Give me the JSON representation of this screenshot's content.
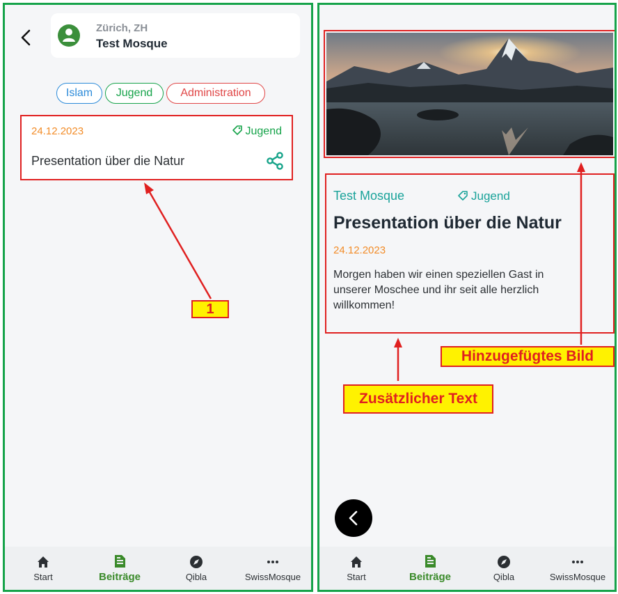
{
  "left": {
    "header": {
      "city": "Zürich, ZH",
      "mosque": "Test Mosque"
    },
    "chips": [
      "Islam",
      "Jugend",
      "Administration"
    ],
    "post": {
      "date": "24.12.2023",
      "tag": "Jugend",
      "title": "Presentation über die Natur"
    },
    "callout": "1"
  },
  "right": {
    "mosque": "Test Mosque",
    "tag": "Jugend",
    "title": "Presentation über die Natur",
    "date": "24.12.2023",
    "body": "Morgen haben wir einen speziellen Gast in unserer Moschee und ihr seit alle herzlich willkommen!",
    "callout_image": "Hinzugefügtes Bild",
    "callout_text": "Zusätzlicher Text"
  },
  "nav": [
    "Start",
    "Beiträge",
    "Qibla",
    "SwissMosque"
  ],
  "colors": {
    "frame": "#16a34a",
    "annotation": "#e02020",
    "callout_bg": "#fff200",
    "teal": "#1aa39a",
    "orange": "#f28c28"
  },
  "icons": [
    "back-chevron-icon",
    "mosque-avatar-icon",
    "tag-icon",
    "share-icon",
    "home-icon",
    "document-icon",
    "compass-icon",
    "more-dots-icon"
  ]
}
